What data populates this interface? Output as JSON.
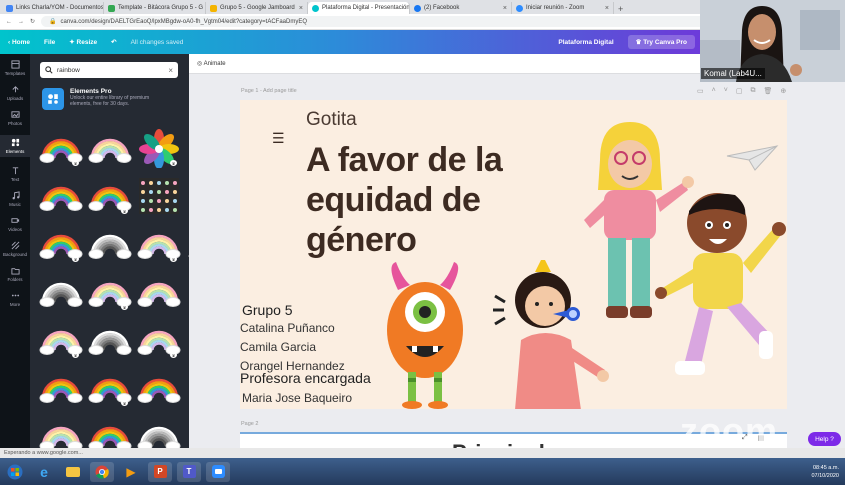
{
  "browser": {
    "tabs": [
      {
        "label": "Links Charla/YOM - Documentos",
        "color": "#4285f4",
        "active": false
      },
      {
        "label": "Template - Bitácora Grupo 5 - G",
        "color": "#34a853",
        "active": false
      },
      {
        "label": "Grupo 5 - Google Jamboard",
        "color": "#f4b400",
        "active": false
      },
      {
        "label": "Plataforma Digital - Presentación",
        "color": "#00c4cc",
        "active": true
      },
      {
        "label": "(2) Facebook",
        "color": "#1877f2",
        "active": false
      },
      {
        "label": "Iniciar reunión - Zoom",
        "color": "#2d8cff",
        "active": false
      }
    ],
    "url": "canva.com/design/DAELTGrEaoQ/lpxMBgdw-oA0-fh_Vgtm04/edit?category=tACFaaDmyEQ"
  },
  "canva_header": {
    "home": "Home",
    "file": "File",
    "resize": "Resize",
    "saved": "All changes saved",
    "project": "Plataforma Digital",
    "try_pro": "Try Canva Pro"
  },
  "rail": [
    {
      "label": "Templates",
      "icon": "templates-icon"
    },
    {
      "label": "Uploads",
      "icon": "upload-icon"
    },
    {
      "label": "Photos",
      "icon": "photos-icon"
    },
    {
      "label": "Elements",
      "icon": "elements-icon",
      "active": true
    },
    {
      "label": "Text",
      "icon": "text-icon"
    },
    {
      "label": "Music",
      "icon": "music-icon"
    },
    {
      "label": "Videos",
      "icon": "video-icon"
    },
    {
      "label": "Background",
      "icon": "background-icon"
    },
    {
      "label": "Folders",
      "icon": "folder-icon"
    },
    {
      "label": "More",
      "icon": "more-icon"
    }
  ],
  "panel": {
    "search_value": "rainbow",
    "promo_title": "Elements Pro",
    "promo_text": "Unlock our entire library of premium elements, free for 30 days."
  },
  "editor": {
    "animate": "Animate",
    "page1_label": "Page 1 - Add page title",
    "page2_label": "Page 2",
    "page2_text": "Principal"
  },
  "slide": {
    "subtitle": "Gotita",
    "title": "A favor de la equidad de género",
    "group": "Grupo 5",
    "members": [
      "Catalina Puñanco",
      "Camila Garcia",
      "Orangel Hernandez"
    ],
    "prof_label": "Profesora encargada",
    "prof_name": "Maria Jose Baqueiro"
  },
  "video": {
    "name": "Komal (Lab4U..."
  },
  "zoom_watermark": "zoom",
  "help": "Help ?",
  "status": "Esperando a www.google.com...",
  "clock": {
    "time": "08:45 a.m.",
    "date": "07/10/2020"
  },
  "colors": {
    "accent": "#7d2ae8",
    "teal": "#00c4cc",
    "slide_bg": "#fbeee1",
    "title": "#3d2b22"
  }
}
